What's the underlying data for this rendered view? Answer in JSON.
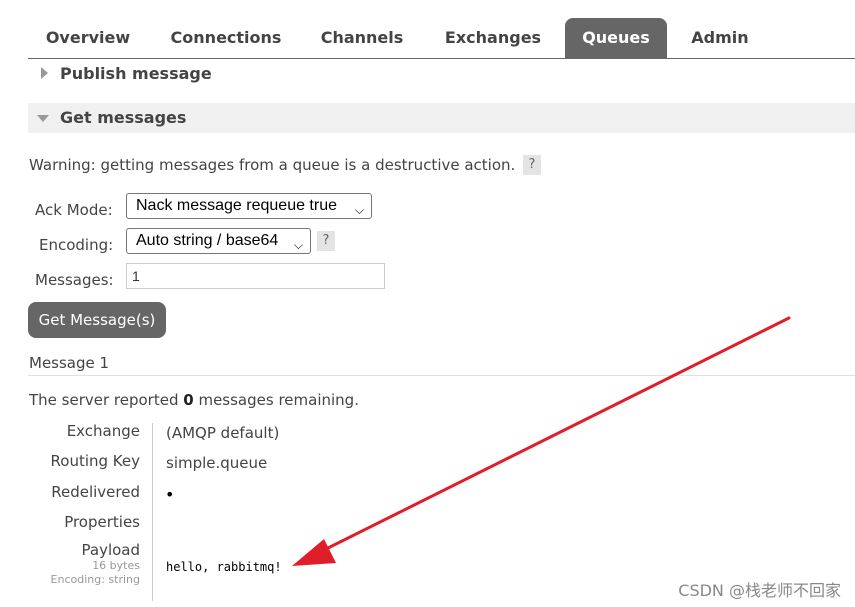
{
  "tabs": [
    {
      "label": "Overview",
      "active": false
    },
    {
      "label": "Connections",
      "active": false
    },
    {
      "label": "Channels",
      "active": false
    },
    {
      "label": "Exchanges",
      "active": false
    },
    {
      "label": "Queues",
      "active": true
    },
    {
      "label": "Admin",
      "active": false
    }
  ],
  "sections": {
    "publish": {
      "label": "Publish message",
      "expanded": false
    },
    "get": {
      "label": "Get messages",
      "expanded": true
    }
  },
  "get_form": {
    "warning": "Warning: getting messages from a queue is a destructive action.",
    "help": "?",
    "ack_mode_label": "Ack Mode:",
    "ack_mode_value": "Nack message requeue true",
    "encoding_label": "Encoding:",
    "encoding_value": "Auto string / base64",
    "messages_label": "Messages:",
    "messages_value": "1",
    "button_label": "Get Message(s)"
  },
  "result": {
    "heading": "Message 1",
    "remaining_prefix": "The server reported ",
    "remaining_count": "0",
    "remaining_suffix": " messages remaining.",
    "props": {
      "exchange_key": "Exchange",
      "exchange_val": "(AMQP default)",
      "routing_key_key": "Routing Key",
      "routing_key_val": "simple.queue",
      "redelivered_key": "Redelivered",
      "redelivered_val": "•",
      "properties_key": "Properties",
      "payload_key": "Payload",
      "payload_size": "16 bytes",
      "payload_encoding": "Encoding: string",
      "payload_val": "hello, rabbitmq!"
    }
  },
  "watermark": "CSDN @栈老师不回家",
  "colors": {
    "tab_active_bg": "#666666",
    "button_bg": "#666666",
    "arrow": "#e01e2a"
  }
}
